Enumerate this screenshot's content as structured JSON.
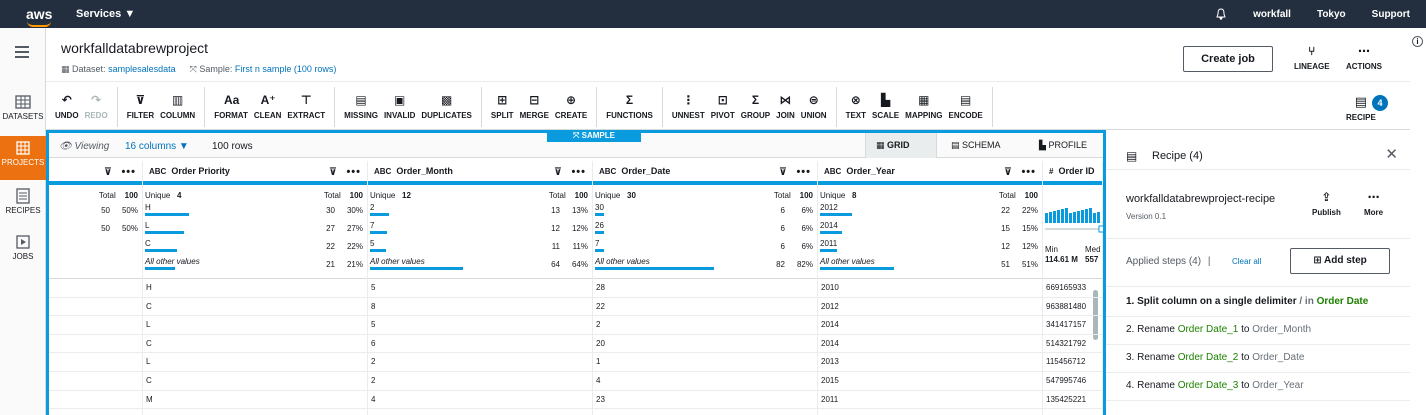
{
  "topbar": {
    "logo": "aws",
    "services": "Services ▼",
    "user": "workfall",
    "region": "Tokyo",
    "support": "Support"
  },
  "leftnav": [
    {
      "label": "DATASETS",
      "active": false
    },
    {
      "label": "PROJECTS",
      "active": true
    },
    {
      "label": "RECIPES",
      "active": false
    },
    {
      "label": "JOBS",
      "active": false
    }
  ],
  "header": {
    "title": "workfalldatabrewproject",
    "dataset_label": "Dataset:",
    "dataset_value": "samplesalesdata",
    "sample_label": "Sample:",
    "sample_value": "First n sample (100 rows)",
    "create_job": "Create job",
    "lineage": "LINEAGE",
    "actions": "ACTIONS"
  },
  "toolbar": {
    "groups": [
      [
        {
          "label": "UNDO",
          "icon": "↶"
        },
        {
          "label": "REDO",
          "icon": "↷",
          "disabled": true
        }
      ],
      [
        {
          "label": "FILTER",
          "icon": "⊽"
        },
        {
          "label": "COLUMN",
          "icon": "▥"
        }
      ],
      [
        {
          "label": "FORMAT",
          "icon": "Aa"
        },
        {
          "label": "CLEAN",
          "icon": "A⁺"
        },
        {
          "label": "EXTRACT",
          "icon": "⊤"
        }
      ],
      [
        {
          "label": "MISSING",
          "icon": "▤"
        },
        {
          "label": "INVALID",
          "icon": "▣"
        },
        {
          "label": "DUPLICATES",
          "icon": "▩"
        }
      ],
      [
        {
          "label": "SPLIT",
          "icon": "⊞"
        },
        {
          "label": "MERGE",
          "icon": "⊟"
        },
        {
          "label": "CREATE",
          "icon": "⊕"
        }
      ],
      [
        {
          "label": "FUNCTIONS",
          "icon": "Σ"
        }
      ],
      [
        {
          "label": "UNNEST",
          "icon": "⋮"
        },
        {
          "label": "PIVOT",
          "icon": "⊡"
        },
        {
          "label": "GROUP",
          "icon": "Σ"
        },
        {
          "label": "JOIN",
          "icon": "⋈"
        },
        {
          "label": "UNION",
          "icon": "⊜"
        }
      ],
      [
        {
          "label": "TEXT",
          "icon": "⊗"
        },
        {
          "label": "SCALE",
          "icon": "▙"
        },
        {
          "label": "MAPPING",
          "icon": "▦"
        },
        {
          "label": "ENCODE",
          "icon": "▤"
        }
      ]
    ],
    "recipe_label": "RECIPE",
    "recipe_count": "4"
  },
  "viewbar": {
    "viewing": "Viewing",
    "columns": "16 columns ▼",
    "rows": "100 rows",
    "sample_tag": "⤧ SAMPLE",
    "tabs": [
      "GRID",
      "SCHEMA",
      "PROFILE"
    ]
  },
  "columns": [
    {
      "name": "",
      "left": 0,
      "width": 94,
      "unique": "",
      "total_label": "Total",
      "total": "100",
      "values": [
        {
          "label": "",
          "count": "50",
          "pct": "50%",
          "frac": 0
        },
        {
          "label": "",
          "count": "50",
          "pct": "50%",
          "frac": 0
        }
      ],
      "cells": [
        "",
        "",
        "",
        "",
        "",
        "",
        "",
        ""
      ]
    },
    {
      "name": "Order Priority",
      "unique": "4",
      "total_label": "Total",
      "total": "100",
      "values": [
        {
          "label": "H",
          "count": "30",
          "pct": "30%",
          "frac": 0.3
        },
        {
          "label": "L",
          "count": "27",
          "pct": "27%",
          "frac": 0.27
        },
        {
          "label": "C",
          "count": "22",
          "pct": "22%",
          "frac": 0.22
        },
        {
          "label": "All other values",
          "count": "21",
          "pct": "21%",
          "frac": 0.21,
          "other": true
        }
      ],
      "cells": [
        "H",
        "C",
        "L",
        "C",
        "L",
        "C",
        "M"
      ]
    },
    {
      "name": "Order_Month",
      "unique": "12",
      "total_label": "Total",
      "total": "100",
      "values": [
        {
          "label": "2",
          "count": "13",
          "pct": "13%",
          "frac": 0.13
        },
        {
          "label": "7",
          "count": "12",
          "pct": "12%",
          "frac": 0.12
        },
        {
          "label": "5",
          "count": "11",
          "pct": "11%",
          "frac": 0.11
        },
        {
          "label": "All other values",
          "count": "64",
          "pct": "64%",
          "frac": 0.64,
          "other": true
        }
      ],
      "cells": [
        "5",
        "8",
        "5",
        "6",
        "2",
        "2",
        "4"
      ]
    },
    {
      "name": "Order_Date",
      "unique": "30",
      "total_label": "Total",
      "total": "100",
      "values": [
        {
          "label": "30",
          "count": "6",
          "pct": "6%",
          "frac": 0.06
        },
        {
          "label": "26",
          "count": "6",
          "pct": "6%",
          "frac": 0.06
        },
        {
          "label": "7",
          "count": "6",
          "pct": "6%",
          "frac": 0.06
        },
        {
          "label": "All other values",
          "count": "82",
          "pct": "82%",
          "frac": 0.82,
          "other": true
        }
      ],
      "cells": [
        "28",
        "22",
        "2",
        "20",
        "1",
        "4",
        "23"
      ]
    },
    {
      "name": "Order_Year",
      "unique": "8",
      "total_label": "Total",
      "total": "100",
      "values": [
        {
          "label": "2012",
          "count": "22",
          "pct": "22%",
          "frac": 0.22
        },
        {
          "label": "2014",
          "count": "15",
          "pct": "15%",
          "frac": 0.15
        },
        {
          "label": "2011",
          "count": "12",
          "pct": "12%",
          "frac": 0.12
        },
        {
          "label": "All other values",
          "count": "51",
          "pct": "51%",
          "frac": 0.51,
          "other": true
        }
      ],
      "cells": [
        "2010",
        "2012",
        "2014",
        "2014",
        "2013",
        "2015",
        "2011"
      ]
    },
    {
      "name": "Order ID",
      "min_label": "Min",
      "min": "114.61 M",
      "med_label": "Med",
      "med": "557",
      "cells": [
        "669165933",
        "963881480",
        "341417157",
        "514321792",
        "115456712",
        "547995746",
        "135425221"
      ]
    }
  ],
  "recipe": {
    "title": "Recipe (4)",
    "name": "workfalldatabrewproject-recipe",
    "version": "Version 0.1",
    "publish": "Publish",
    "more": "More",
    "steps_header": "Applied steps (4)",
    "separator": "|",
    "clear_all": "Clear all",
    "add_step": "Add step",
    "steps": [
      {
        "prefix": "1. Split column on a single delimiter",
        "mid": " / in ",
        "target": "Order Date",
        "style": "split"
      },
      {
        "prefix": "2. Rename ",
        "from": "Order Date_1",
        "mid": " to ",
        "to": "Order_Month",
        "style": "rename"
      },
      {
        "prefix": "3. Rename ",
        "from": "Order Date_2",
        "mid": " to ",
        "to": "Order_Date",
        "style": "rename"
      },
      {
        "prefix": "4. Rename ",
        "from": "Order Date_3",
        "mid": " to ",
        "to": "Order_Year",
        "style": "rename"
      }
    ]
  },
  "colors": {
    "accent": "#0a9bdf",
    "active_nav": "#ec7211",
    "topbar": "#232f3e",
    "green": "#1d8102",
    "link": "#0073bb"
  }
}
